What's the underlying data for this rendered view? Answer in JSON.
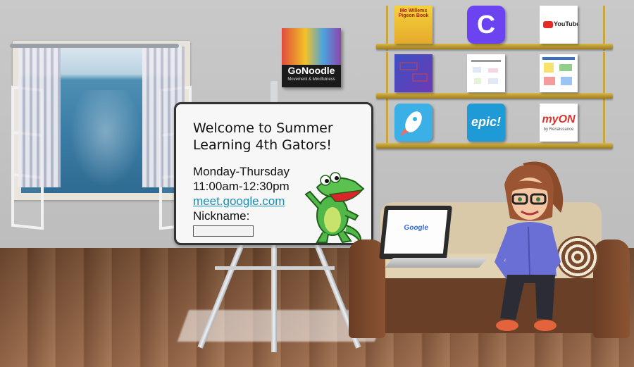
{
  "whiteboard": {
    "welcome": "Welcome to Summer Learning 4th Gators!",
    "days": "Monday-Thursday",
    "time": "11:00am-12:30pm",
    "meet_link": "meet.google.com",
    "nickname_label": "Nickname:",
    "nickname_value": ""
  },
  "gonoodle": {
    "title": "GoNoodle",
    "subtitle": "Movement & Mindfulness"
  },
  "shelf": {
    "pigeon_text": "Mo Willems Pigeon Book",
    "c_app_letter": "C",
    "youtube_label": "YouTube",
    "epic_label": "epic!",
    "myon_label": "myON",
    "myon_sub": "by Renaissance"
  },
  "laptop": {
    "screen_text": "Google"
  },
  "colors": {
    "link": "#1a8fb5",
    "wall": "#c4c4c4",
    "epic": "#1e9ad6",
    "canvas": "#6c43f0",
    "youtube_red": "#e52d27"
  }
}
